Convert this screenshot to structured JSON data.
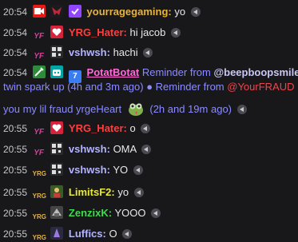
{
  "colors": {
    "background": "#18181b",
    "timestamp": "#c8c8cc",
    "reminder": "#8b8bff",
    "mention_red": "#f0444b"
  },
  "messages": [
    {
      "time": "20:54",
      "badges": [
        "live-badge-icon",
        "ysf-badge-icon",
        "subscriber-badge-icon"
      ],
      "user": "yourragegaming",
      "user_color": "#e7b33c",
      "text": "yo"
    },
    {
      "time": "20:54",
      "badges": [
        "yrg-team-badge-icon",
        "heart-badge-icon"
      ],
      "user": "YRG_Hater",
      "user_color": "#ff3d3d",
      "text": "hi jacob"
    },
    {
      "time": "20:54",
      "badges": [
        "yrg-team-badge-icon",
        "qr-badge-icon"
      ],
      "user": "vshwsh",
      "user_color": "#b4b4ff",
      "text": "hachi"
    },
    {
      "time": "20:54",
      "badges": [
        "sword-badge-icon",
        "bot-badge-icon",
        "seven-tv-badge-icon"
      ],
      "user": "PotatBotat",
      "user_color": "#ff6bd6",
      "reminder_text": "Reminder from ",
      "reminder_mention": "@beepboopsmile",
      "line2_text": "twin spark up (4h and 3m ago) ● Reminder from ",
      "line2_mention": "@YourFRAUD",
      "line3_text": "you my lil fraud yrgeHeart",
      "line3_after": "(2h and 19m ago)"
    },
    {
      "time": "20:55",
      "badges": [
        "yrg-team-badge-icon",
        "heart-badge-icon"
      ],
      "user": "YRG_Hater",
      "user_color": "#ff3d3d",
      "text": "o"
    },
    {
      "time": "20:55",
      "badges": [
        "yrg-team-badge-icon",
        "qr-badge-icon"
      ],
      "user": "vshwsh",
      "user_color": "#b4b4ff",
      "text": "OMA"
    },
    {
      "time": "20:55",
      "badges": [
        "yrg-small-badge-icon",
        "qr-badge-icon"
      ],
      "user": "vshwsh",
      "user_color": "#b4b4ff",
      "text": "YO"
    },
    {
      "time": "20:55",
      "badges": [
        "yrg-small-badge-icon",
        "avatar-badge-icon"
      ],
      "user": "LimitsF2",
      "user_color": "#e8e83a",
      "text": "yo"
    },
    {
      "time": "20:55",
      "badges": [
        "yrg-small-badge-icon",
        "avatar-badge-icon"
      ],
      "user": "ZenzixK",
      "user_color": "#3ddc4b",
      "text": "YOOO"
    },
    {
      "time": "20:55",
      "badges": [
        "yrg-small-badge-icon",
        "avatar-badge-icon"
      ],
      "user": "Luffics",
      "user_color": "#b4b4ff",
      "text": "O"
    }
  ]
}
